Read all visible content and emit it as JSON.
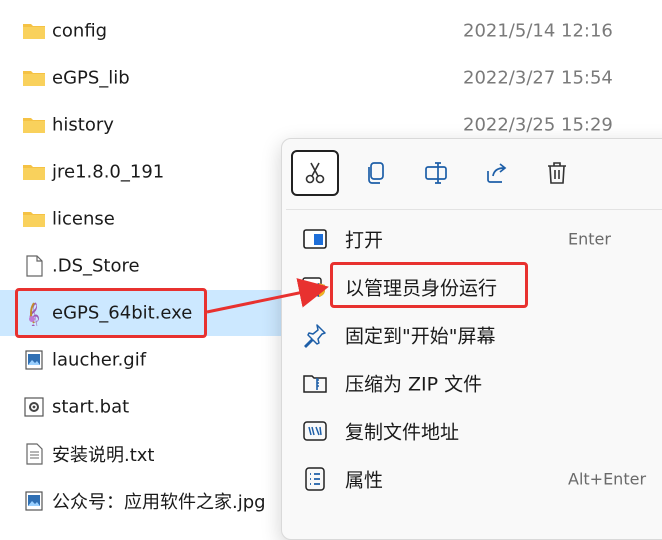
{
  "files": [
    {
      "name": "config",
      "date": "2021/5/14 12:16",
      "icon": "folder-icon"
    },
    {
      "name": "eGPS_lib",
      "date": "2022/3/27 15:54",
      "icon": "folder-icon"
    },
    {
      "name": "history",
      "date": "2022/3/25 15:29",
      "icon": "folder-icon"
    },
    {
      "name": "jre1.8.0_191",
      "date": "",
      "icon": "folder-icon"
    },
    {
      "name": "license",
      "date": "",
      "icon": "folder-icon"
    },
    {
      "name": ".DS_Store",
      "date": "",
      "icon": "file-icon"
    },
    {
      "name": "eGPS_64bit.exe",
      "date": "",
      "icon": "exe-icon"
    },
    {
      "name": "laucher.gif",
      "date": "",
      "icon": "image-file-icon"
    },
    {
      "name": "start.bat",
      "date": "",
      "icon": "bat-file-icon"
    },
    {
      "name": "安装说明.txt",
      "date": "",
      "icon": "text-file-icon"
    },
    {
      "name": "公众号：应用软件之家.jpg",
      "date": "",
      "icon": "image-file-icon"
    }
  ],
  "context_menu": {
    "toolbar": [
      {
        "name": "cut",
        "icon": "scissors-icon"
      },
      {
        "name": "copy",
        "icon": "copy-icon"
      },
      {
        "name": "rename",
        "icon": "rename-icon"
      },
      {
        "name": "share",
        "icon": "share-icon"
      },
      {
        "name": "delete",
        "icon": "trash-icon"
      }
    ],
    "items": [
      {
        "label": "打开",
        "shortcut": "Enter",
        "icon": "open-window-icon"
      },
      {
        "label": "以管理员身份运行",
        "shortcut": "",
        "icon": "admin-shield-icon"
      },
      {
        "label": "固定到\"开始\"屏幕",
        "shortcut": "",
        "icon": "pin-icon"
      },
      {
        "label": "压缩为 ZIP 文件",
        "shortcut": "",
        "icon": "zip-folder-icon"
      },
      {
        "label": "复制文件地址",
        "shortcut": "",
        "icon": "copy-path-icon"
      },
      {
        "label": "属性",
        "shortcut": "Alt+Enter",
        "icon": "properties-icon"
      }
    ]
  },
  "colors": {
    "selection": "#cce8ff",
    "annotation": "#e8312f",
    "folder": "#f5c244",
    "accent": "#0067c0"
  }
}
